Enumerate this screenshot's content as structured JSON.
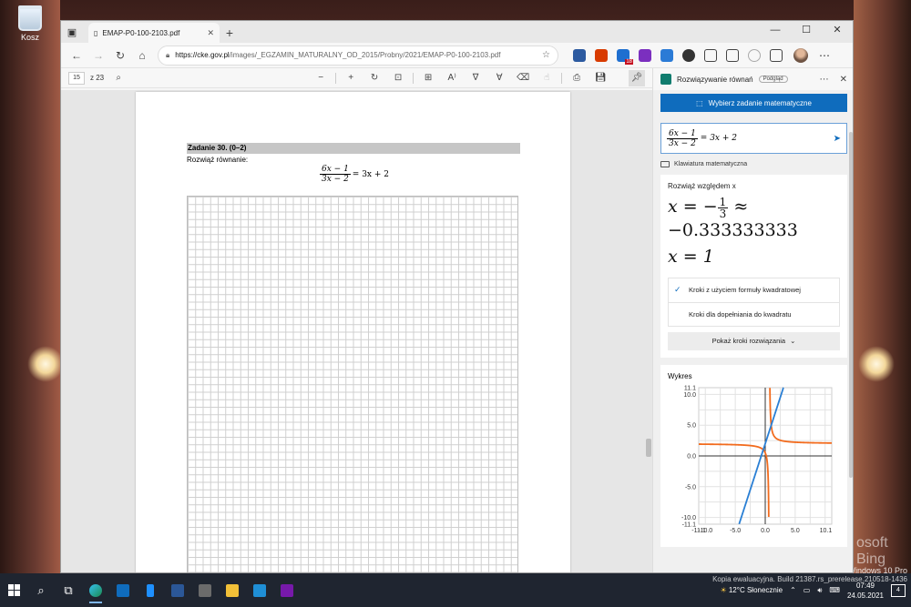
{
  "desktop": {
    "recycle_bin_label": "Kosz",
    "watermark_line1": "Windows 10 Pro",
    "watermark_line2": "Kopia ewaluacyjna. Build 21387.rs_prerelease.210518-1436",
    "bing_text": "osoft Bing"
  },
  "browser": {
    "tab_title": "EMAP-P0-100-2103.pdf",
    "url_scheme_host": "https://cke.gov.pl",
    "url_path": "/images/_EGZAMIN_MATURALNY_OD_2015/Probny/2021/EMAP-P0-100-2103.pdf",
    "ext_badge": "18",
    "window_controls": [
      "—",
      "☐",
      "✕"
    ]
  },
  "pdf_toolbar": {
    "page_current": "15",
    "page_total": "z 23"
  },
  "pdf": {
    "task_heading": "Zadanie 30. (0–2)",
    "task_instruction": "Rozwiąż równanie:",
    "equation_numerator": "6x − 1",
    "equation_denominator": "3x − 2",
    "equation_rhs": "= 3x + 2"
  },
  "solver": {
    "title": "Rozwiązywanie równań",
    "preview_badge": "Podgląd",
    "select_button": "Wybierz zadanie matematyczne",
    "input_numerator": "6x − 1",
    "input_denominator": "3x − 2",
    "input_rhs": "= 3x + 2",
    "keyboard_label": "Klawiatura matematyczna",
    "solve_for": "Rozwiąż względem x",
    "solution1_lhs": "x = −",
    "solution1_frac_num": "1",
    "solution1_frac_den": "3",
    "solution1_approx": "≈",
    "solution1_decimal": "−0.333333333",
    "solution2": "x = 1",
    "method1": "Kroki z użyciem formuły kwadratowej",
    "method2": "Kroki dla dopełniania do kwadratu",
    "show_steps": "Pokaż kroki rozwiązania",
    "graph_title": "Wykres"
  },
  "chart_data": {
    "type": "line",
    "title": "Wykres",
    "xlim": [
      -11.1,
      11.1
    ],
    "ylim": [
      -11.1,
      11.1
    ],
    "x_ticks": [
      "-11.1",
      "-10.0",
      "-5.0",
      "0.0",
      "5.0",
      "10.1"
    ],
    "y_ticks": [
      "11.1",
      "10.0",
      "5.0",
      "0.0",
      "-5.0",
      "-10.0",
      "-11.1"
    ],
    "grid": true,
    "series": [
      {
        "function": "(6x-1)/(3x-2)",
        "color": "#f26b1d"
      },
      {
        "function": "3x+2",
        "color": "#2a7fd4"
      }
    ]
  },
  "taskbar": {
    "weather": "12°C  Słonecznie",
    "time": "07:49",
    "date": "24.05.2021",
    "notifications": "4"
  }
}
